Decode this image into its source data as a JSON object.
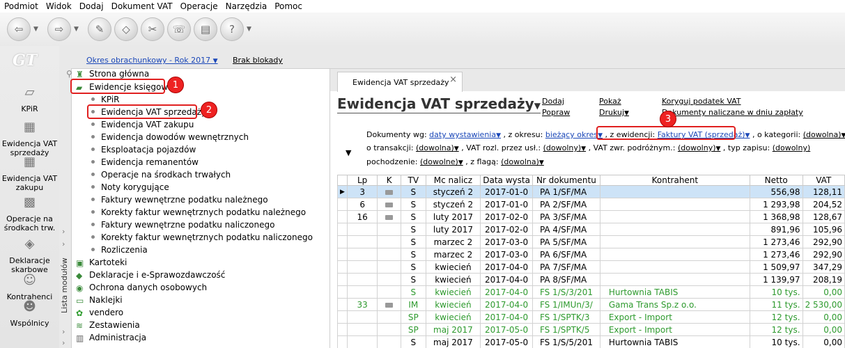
{
  "menu": [
    "Podmiot",
    "Widok",
    "Dodaj",
    "Dokument VAT",
    "Operacje",
    "Narzędzia",
    "Pomoc"
  ],
  "logo": "GT",
  "rail": [
    {
      "label": "KPiR",
      "icon": "kpir-icon"
    },
    {
      "label": "Ewidencja VAT sprzedaży",
      "icon": "vat-sales-icon"
    },
    {
      "label": "Ewidencja VAT zakupu",
      "icon": "vat-purchase-icon"
    },
    {
      "label": "Operacje na środkach trw.",
      "icon": "fixed-assets-icon"
    },
    {
      "label": "Deklaracje skarbowe",
      "icon": "declarations-icon"
    },
    {
      "label": "Kontrahenci",
      "icon": "contractors-icon"
    },
    {
      "label": "Wspólnicy",
      "icon": "partners-icon"
    }
  ],
  "strip_label": "Lista modułów",
  "period": {
    "label": "Okres obrachunkowy - Rok 2017",
    "lock": "Brak blokady"
  },
  "tree": {
    "home": "Strona główna",
    "books": "Ewidencje księgowe",
    "children": [
      "KPiR",
      "Ewidencja VAT sprzedaży",
      "Ewidencja VAT zakupu",
      "Ewidencja dowodów wewnętrznych",
      "Eksploatacja pojazdów",
      "Ewidencja remanentów",
      "Operacje na środkach trwałych",
      "Noty korygujące",
      "Faktury wewnętrzne podatku należnego",
      "Korekty faktur wewnętrznych podatku należnego",
      "Faktury wewnętrzne podatku naliczonego",
      "Korekty faktur wewnętrznych podatku naliczonego",
      "Rozliczenia"
    ],
    "groups": [
      "Kartoteki",
      "Deklaracje i e-Sprawozdawczość",
      "Ochrona danych osobowych",
      "Naklejki",
      "vendero",
      "Zestawienia",
      "Administracja"
    ]
  },
  "badges": [
    "1",
    "2",
    "3"
  ],
  "tab": {
    "label": "Ewidencja VAT sprzedaży",
    "close": "×"
  },
  "title": "Ewidencja VAT sprzedaży",
  "actions": {
    "add": "Dodaj",
    "fix": "Popraw",
    "show": "Pokaż",
    "print": "Drukuj",
    "correct": "Koryguj podatek VAT",
    "docs": "Dokumenty naliczane w dniu zapłaty"
  },
  "filters": {
    "docs_by": "Dokumenty wg:",
    "docs_by_val": "daty wystawienia",
    "period_lbl": ", z okresu:",
    "period_val": "bieżący okres",
    "reg_lbl": ", z ewidencji:",
    "reg_val": "Faktury VAT (sprzedaż)",
    "cat_lbl": ", o kategorii:",
    "cat_val": "(dowolna)",
    "trans_lbl": "o transakcji:",
    "trans_val": "(dowolna)",
    "vat_lbl": ", VAT rozl. przez usł.:",
    "vat_val": "(dowolny)",
    "ret_lbl": ", VAT zwr. podróżnym.:",
    "ret_val": "(dowolny)",
    "rec_lbl": ", typ zapisu:",
    "rec_val": "(dowolny)",
    "origin_lbl": "pochodzenie:",
    "origin_val": "(dowolne)",
    "flag_lbl": ", z flagą:",
    "flag_val": "(dowolna)"
  },
  "columns": [
    "Lp",
    "K",
    "TV",
    "Mc nalicz",
    "Data wysta",
    "Nr dokumentu",
    "Kontrahent",
    "Netto",
    "VAT"
  ],
  "rows": [
    {
      "lp": "3",
      "k": true,
      "tv": "S",
      "mc": "styczeń 2",
      "data": "2017-01-0",
      "nr": "PA 1/SF/MA",
      "kontrahent": "",
      "netto": "556,98",
      "vat": "128,11",
      "sel": true,
      "green": false
    },
    {
      "lp": "6",
      "k": true,
      "tv": "S",
      "mc": "styczeń 2",
      "data": "2017-01-0",
      "nr": "PA 2/SF/MA",
      "kontrahent": "",
      "netto": "1 293,98",
      "vat": "204,52",
      "sel": false,
      "green": false
    },
    {
      "lp": "16",
      "k": true,
      "tv": "S",
      "mc": "luty 2017",
      "data": "2017-02-0",
      "nr": "PA 3/SF/MA",
      "kontrahent": "",
      "netto": "1 368,98",
      "vat": "128,67",
      "sel": false,
      "green": false
    },
    {
      "lp": "",
      "k": false,
      "tv": "S",
      "mc": "luty 2017",
      "data": "2017-02-0",
      "nr": "PA 4/SF/MA",
      "kontrahent": "",
      "netto": "891,96",
      "vat": "105,96",
      "sel": false,
      "green": false
    },
    {
      "lp": "",
      "k": false,
      "tv": "S",
      "mc": "marzec 2",
      "data": "2017-03-0",
      "nr": "PA 5/SF/MA",
      "kontrahent": "",
      "netto": "1 273,46",
      "vat": "292,90",
      "sel": false,
      "green": false
    },
    {
      "lp": "",
      "k": false,
      "tv": "S",
      "mc": "marzec 2",
      "data": "2017-03-0",
      "nr": "PA 6/SF/MA",
      "kontrahent": "",
      "netto": "1 273,46",
      "vat": "292,90",
      "sel": false,
      "green": false
    },
    {
      "lp": "",
      "k": false,
      "tv": "S",
      "mc": "kwiecień",
      "data": "2017-04-0",
      "nr": "PA 7/SF/MA",
      "kontrahent": "",
      "netto": "1 509,97",
      "vat": "347,29",
      "sel": false,
      "green": false
    },
    {
      "lp": "",
      "k": false,
      "tv": "S",
      "mc": "kwiecień",
      "data": "2017-04-0",
      "nr": "PA 8/SF/MA",
      "kontrahent": "",
      "netto": "1 139,97",
      "vat": "208,19",
      "sel": false,
      "green": false
    },
    {
      "lp": "",
      "k": false,
      "tv": "S",
      "mc": "kwiecień",
      "data": "2017-04-0",
      "nr": "FS 1/S/3/201",
      "kontrahent": "Hurtownia TABIS",
      "netto": "10 tys.",
      "vat": "0,00",
      "sel": false,
      "green": true
    },
    {
      "lp": "33",
      "k": true,
      "tv": "IM",
      "mc": "kwiecień",
      "data": "2017-04-0",
      "nr": "FS 1/IMUn/3/",
      "kontrahent": "Gama Trans Sp.z o.o.",
      "netto": "11 tys.",
      "vat": "2 530,00",
      "sel": false,
      "green": true
    },
    {
      "lp": "",
      "k": false,
      "tv": "SP",
      "mc": "kwiecień",
      "data": "2017-04-0",
      "nr": "FS 1/SPTK/3",
      "kontrahent": "Export - Import",
      "netto": "12 tys.",
      "vat": "0,00",
      "sel": false,
      "green": true
    },
    {
      "lp": "",
      "k": false,
      "tv": "SP",
      "mc": "maj 2017",
      "data": "2017-05-0",
      "nr": "FS 1/SPTK/5",
      "kontrahent": "Export - Import",
      "netto": "12 tys.",
      "vat": "0,00",
      "sel": false,
      "green": true
    },
    {
      "lp": "",
      "k": false,
      "tv": "S",
      "mc": "maj 2017",
      "data": "2017-05-0",
      "nr": "FS 1/S/5/201",
      "kontrahent": "Hurtownia TABIS",
      "netto": "10 tys.",
      "vat": "0,00",
      "sel": false,
      "green": false
    }
  ]
}
